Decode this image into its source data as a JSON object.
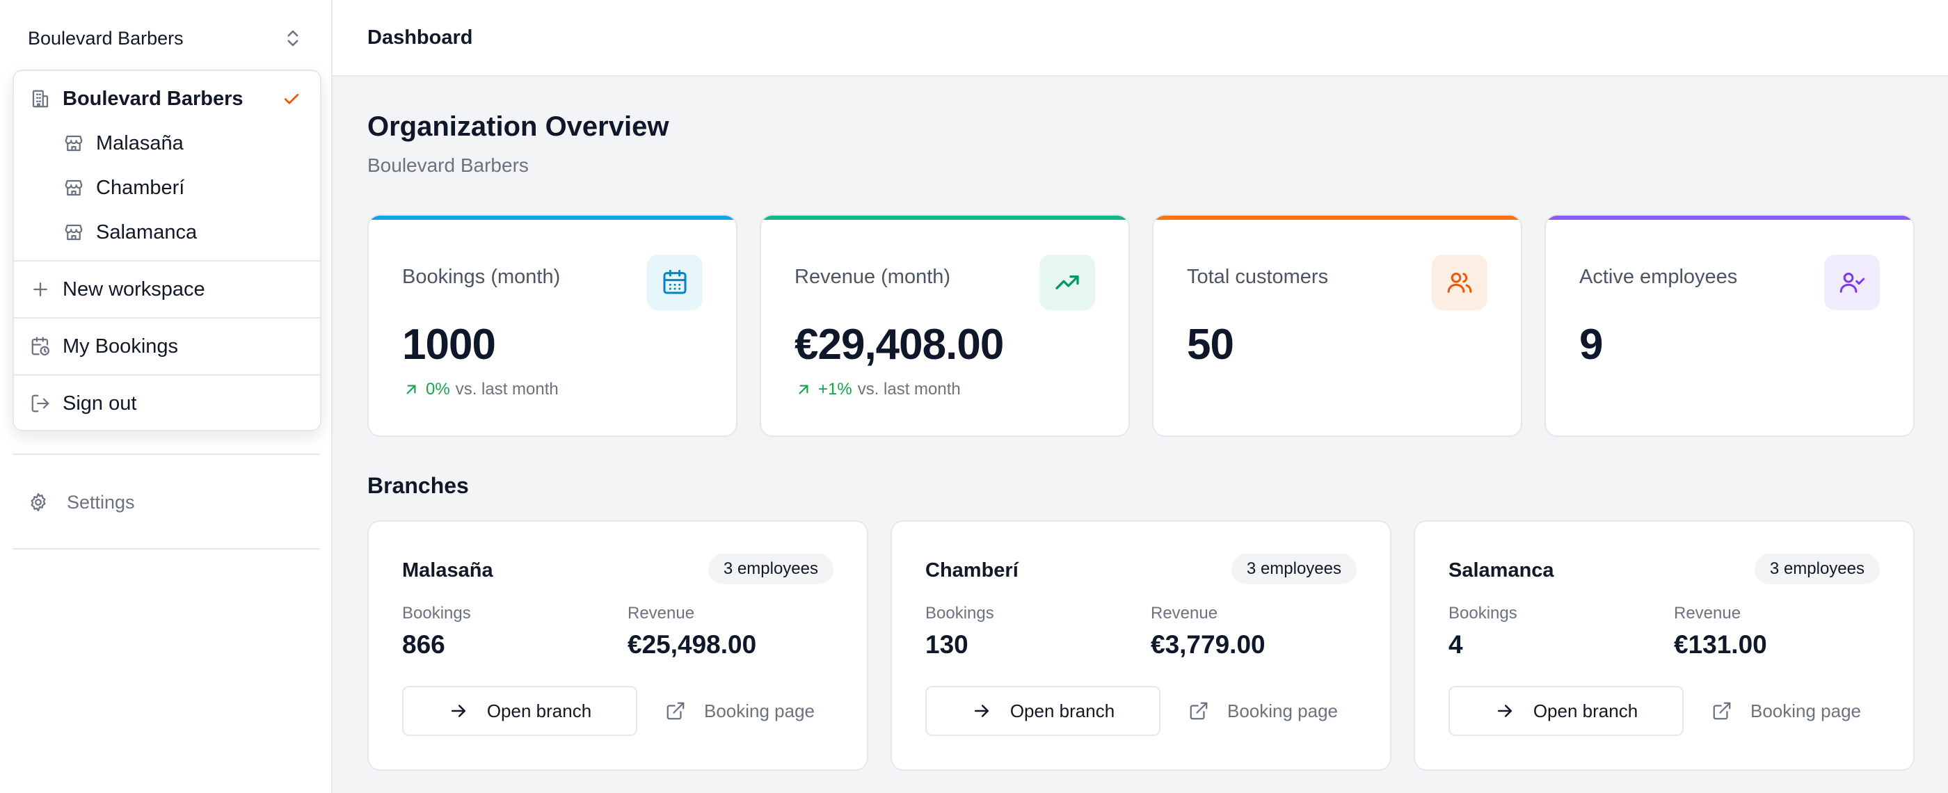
{
  "workspace": {
    "current": "Boulevard Barbers"
  },
  "dropdown": {
    "org": "Boulevard Barbers",
    "branches": [
      "Malasaña",
      "Chamberí",
      "Salamanca"
    ],
    "new_workspace": "New workspace",
    "my_bookings": "My Bookings",
    "sign_out": "Sign out"
  },
  "sidebar": {
    "settings": "Settings"
  },
  "topbar": {
    "title": "Dashboard"
  },
  "overview": {
    "title": "Organization Overview",
    "subtitle": "Boulevard Barbers"
  },
  "stats": [
    {
      "label": "Bookings (month)",
      "value": "1000",
      "delta": "0%",
      "delta_suffix": "vs. last month",
      "icon": "calendar-icon",
      "color": "#0284c7",
      "bg": "#e6f6fb"
    },
    {
      "label": "Revenue (month)",
      "value": "€29,408.00",
      "delta": "+1%",
      "delta_suffix": "vs. last month",
      "icon": "trending-up-icon",
      "color": "#16a34a",
      "bg": "#e6f7f1"
    },
    {
      "label": "Total customers",
      "value": "50",
      "icon": "users-icon",
      "color": "#ea580c",
      "bg": "#fdeee3"
    },
    {
      "label": "Active employees",
      "value": "9",
      "icon": "user-check-icon",
      "color": "#7c3aed",
      "bg": "#f1ecfd"
    }
  ],
  "branches_section": {
    "title": "Branches",
    "metric_labels": {
      "bookings": "Bookings",
      "revenue": "Revenue"
    },
    "open_label": "Open branch",
    "booking_label": "Booking page",
    "items": [
      {
        "name": "Malasaña",
        "employees": "3 employees",
        "bookings": "866",
        "revenue": "€25,498.00"
      },
      {
        "name": "Chamberí",
        "employees": "3 employees",
        "bookings": "130",
        "revenue": "€3,779.00"
      },
      {
        "name": "Salamanca",
        "employees": "3 employees",
        "bookings": "4",
        "revenue": "€131.00"
      }
    ]
  }
}
